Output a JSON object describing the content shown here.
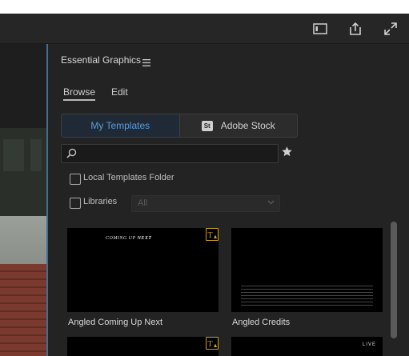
{
  "toolbar": {
    "icons": [
      "panel-toggle-icon",
      "export-icon",
      "fullscreen-icon"
    ]
  },
  "panel": {
    "title": "Essential Graphics",
    "menu_icon": "hamburger-icon",
    "tabs": [
      {
        "label": "Browse",
        "active": true
      },
      {
        "label": "Edit",
        "active": false
      }
    ],
    "segment": {
      "my_templates": "My Templates",
      "adobe_stock_badge": "St",
      "adobe_stock": "Adobe Stock"
    },
    "search": {
      "placeholder": "",
      "value": ""
    },
    "local_templates_label": "Local Templates Folder",
    "libraries_label": "Libraries",
    "libraries_select": "All",
    "templates": [
      {
        "label": "Angled Coming Up Next",
        "text_coming": "COMING UP",
        "text_next": "NEXT",
        "warning": true
      },
      {
        "label": "Angled Credits",
        "warning": false
      },
      {
        "label": "",
        "warning": true
      },
      {
        "label": "",
        "badge": "LIVE",
        "warning": false
      }
    ]
  },
  "colors": {
    "accent": "#5b9bd8",
    "warning": "#c9a227",
    "panel_bg": "#232323"
  }
}
